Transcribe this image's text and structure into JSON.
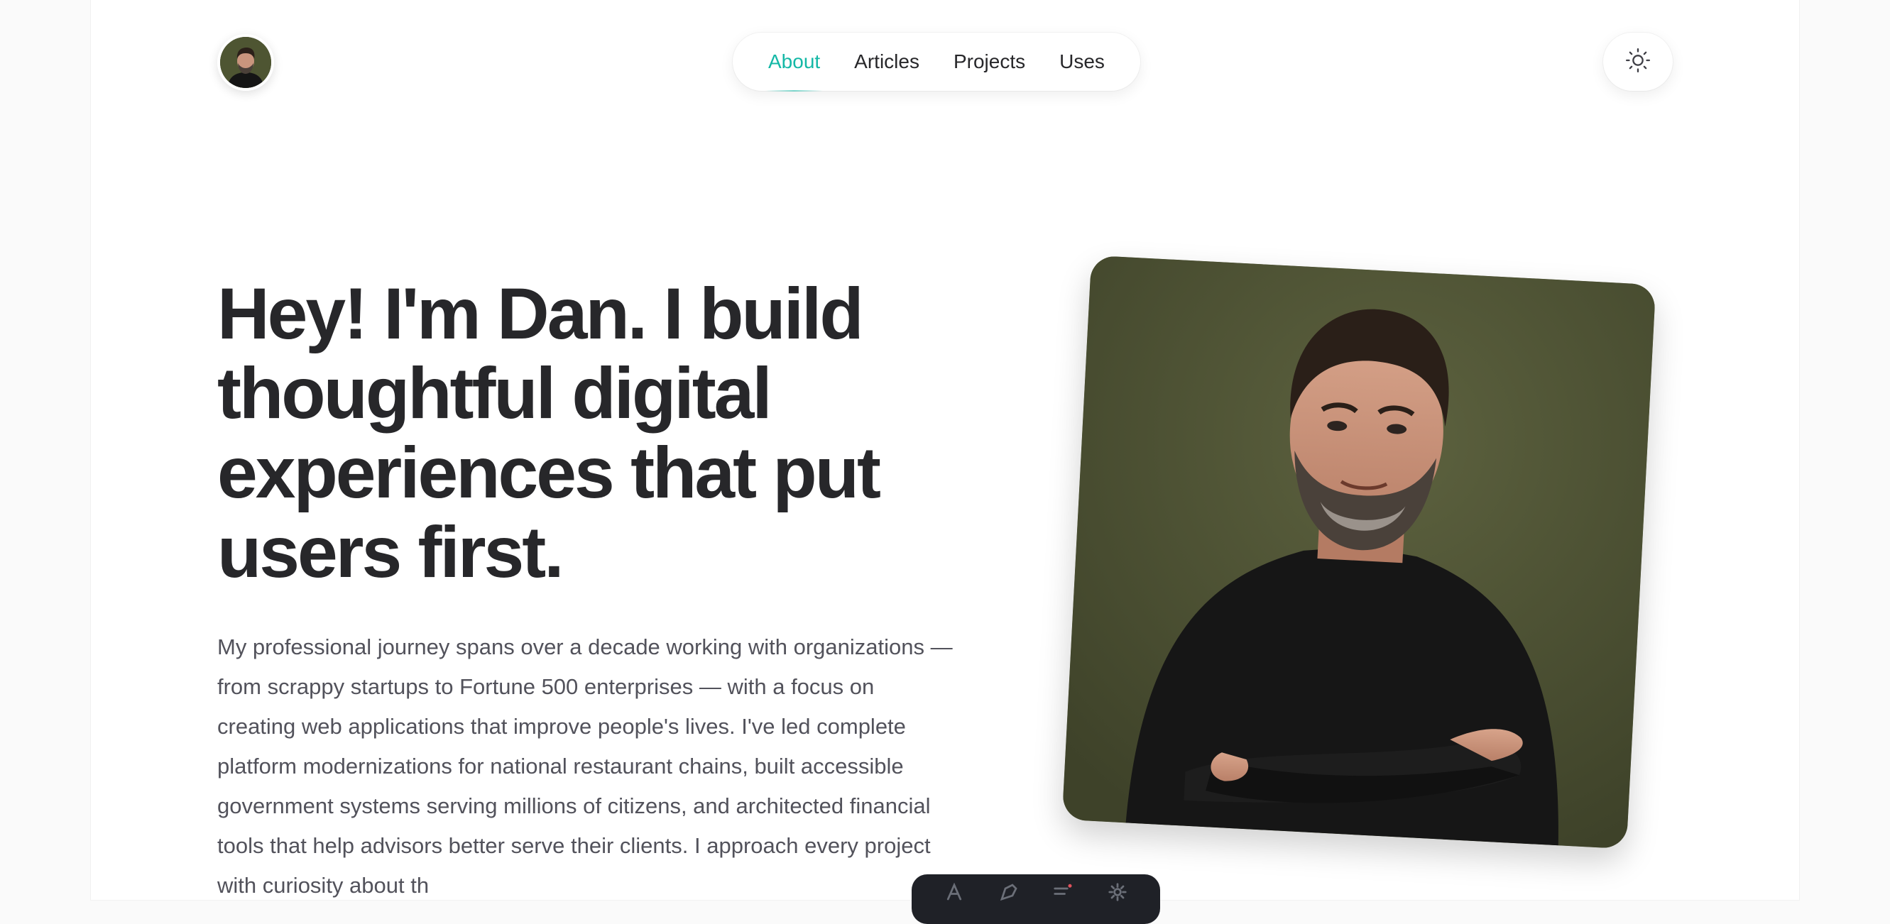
{
  "nav": {
    "items": [
      {
        "label": "About",
        "active": true
      },
      {
        "label": "Articles",
        "active": false
      },
      {
        "label": "Projects",
        "active": false
      },
      {
        "label": "Uses",
        "active": false
      }
    ]
  },
  "hero": {
    "title": "Hey! I'm Dan. I build thoughtful digital experiences that put users first.",
    "body": "My professional journey spans over a decade working with organizations — from scrappy startups to Fortune 500 enterprises — with a focus on creating web applications that improve people's lives. I've led complete platform modernizations for national restaurant chains, built accessible government systems serving millions of citizens, and architected financial tools that help advisors better serve their clients. I approach every project with curiosity about th"
  },
  "icons": {
    "theme_toggle": "sun-icon",
    "dock": [
      "font-icon",
      "pen-icon",
      "list-icon",
      "settings-icon"
    ]
  },
  "colors": {
    "accent": "#14b8a6",
    "heading": "#27272a",
    "body_text": "#52525b",
    "page_bg": "#fafafa",
    "card_bg": "#ffffff",
    "photo_bg": "#535838",
    "dock_bg": "#1f2127"
  }
}
